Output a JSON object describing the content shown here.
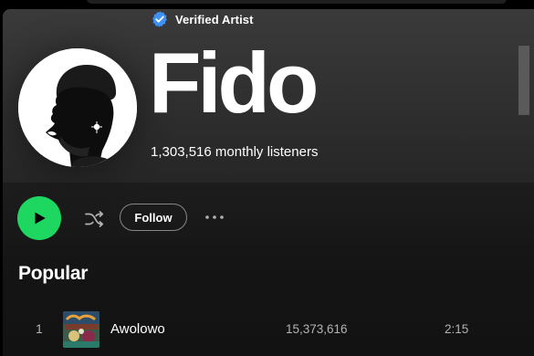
{
  "artist": {
    "verified_label": "Verified Artist",
    "name": "Fido",
    "monthly_listeners": "1,303,516 monthly listeners"
  },
  "controls": {
    "follow_label": "Follow",
    "more_label": "···"
  },
  "popular": {
    "title": "Popular",
    "tracks": [
      {
        "number": "1",
        "title": "Awolowo",
        "plays": "15,373,616",
        "duration": "2:15"
      }
    ]
  },
  "colors": {
    "accent_green": "#1ed760",
    "verified_blue": "#3d91f4",
    "text_primary": "#ffffff",
    "text_secondary": "#b3b3b3",
    "background": "#121212"
  },
  "icons": {
    "verified": "verified-badge-icon",
    "play": "play-icon",
    "shuffle": "shuffle-icon",
    "more": "more-horizontal-icon"
  }
}
